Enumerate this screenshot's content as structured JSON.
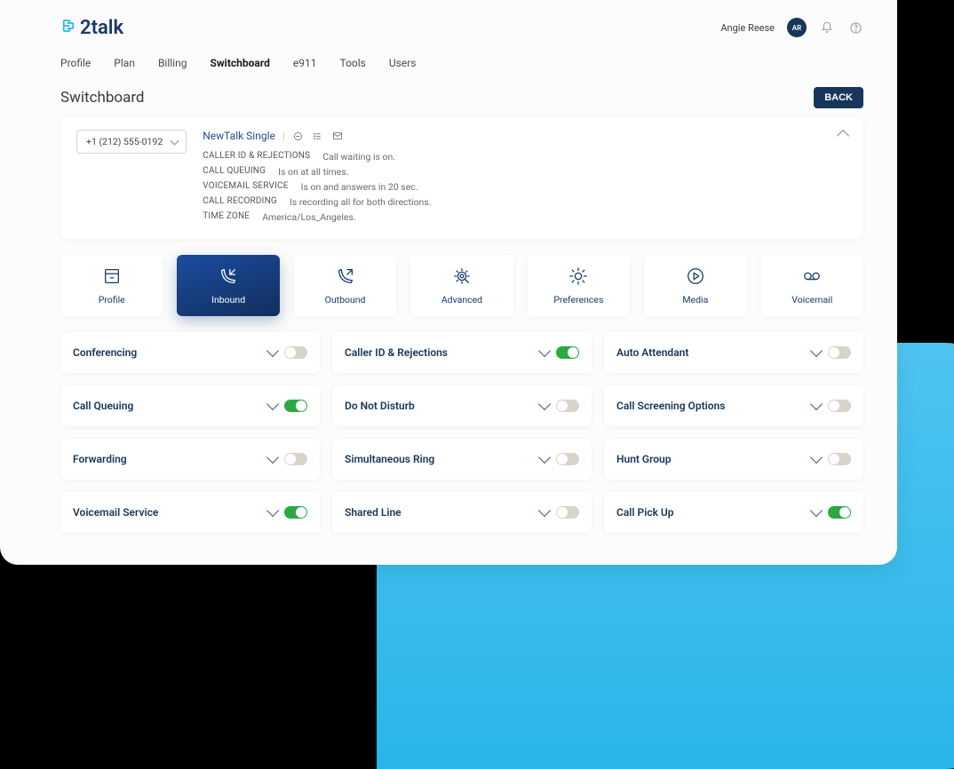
{
  "logo": {
    "text": "2talk"
  },
  "user": {
    "name": "Angie Reese",
    "initials": "AR"
  },
  "nav": {
    "items": [
      "Profile",
      "Plan",
      "Billing",
      "Switchboard",
      "e911",
      "Tools",
      "Users"
    ],
    "active_index": 3
  },
  "page": {
    "title": "Switchboard"
  },
  "back_button": "BACK",
  "phone_selector": "+1 (212) 555-0192",
  "summary": {
    "title": "NewTalk Single",
    "rows": [
      {
        "label": "CALLER ID & REJECTIONS",
        "value": "Call waiting is on."
      },
      {
        "label": "CALL QUEUING",
        "value": "Is on at all times."
      },
      {
        "label": "VOICEMAIL SERVICE",
        "value": "Is on and answers in 20 sec."
      },
      {
        "label": "CALL RECORDING",
        "value": "Is recording all for both directions."
      },
      {
        "label": "TIME ZONE",
        "value": "America/Los_Angeles."
      }
    ]
  },
  "tiles": [
    {
      "label": "Profile",
      "icon": "profile"
    },
    {
      "label": "Inbound",
      "icon": "inbound"
    },
    {
      "label": "Outbound",
      "icon": "outbound"
    },
    {
      "label": "Advanced",
      "icon": "advanced"
    },
    {
      "label": "Preferences",
      "icon": "preferences"
    },
    {
      "label": "Media",
      "icon": "media"
    },
    {
      "label": "Voicemail",
      "icon": "voicemail"
    }
  ],
  "tiles_active_index": 1,
  "features": [
    {
      "name": "Conferencing",
      "on": false
    },
    {
      "name": "Caller ID & Rejections",
      "on": true
    },
    {
      "name": "Auto Attendant",
      "on": false
    },
    {
      "name": "Call Queuing",
      "on": true
    },
    {
      "name": "Do Not Disturb",
      "on": false
    },
    {
      "name": "Call Screening Options",
      "on": false
    },
    {
      "name": "Forwarding",
      "on": false
    },
    {
      "name": "Simultaneous Ring",
      "on": false
    },
    {
      "name": "Hunt Group",
      "on": false
    },
    {
      "name": "Voicemail Service",
      "on": true
    },
    {
      "name": "Shared Line",
      "on": false
    },
    {
      "name": "Call Pick Up",
      "on": true
    }
  ]
}
